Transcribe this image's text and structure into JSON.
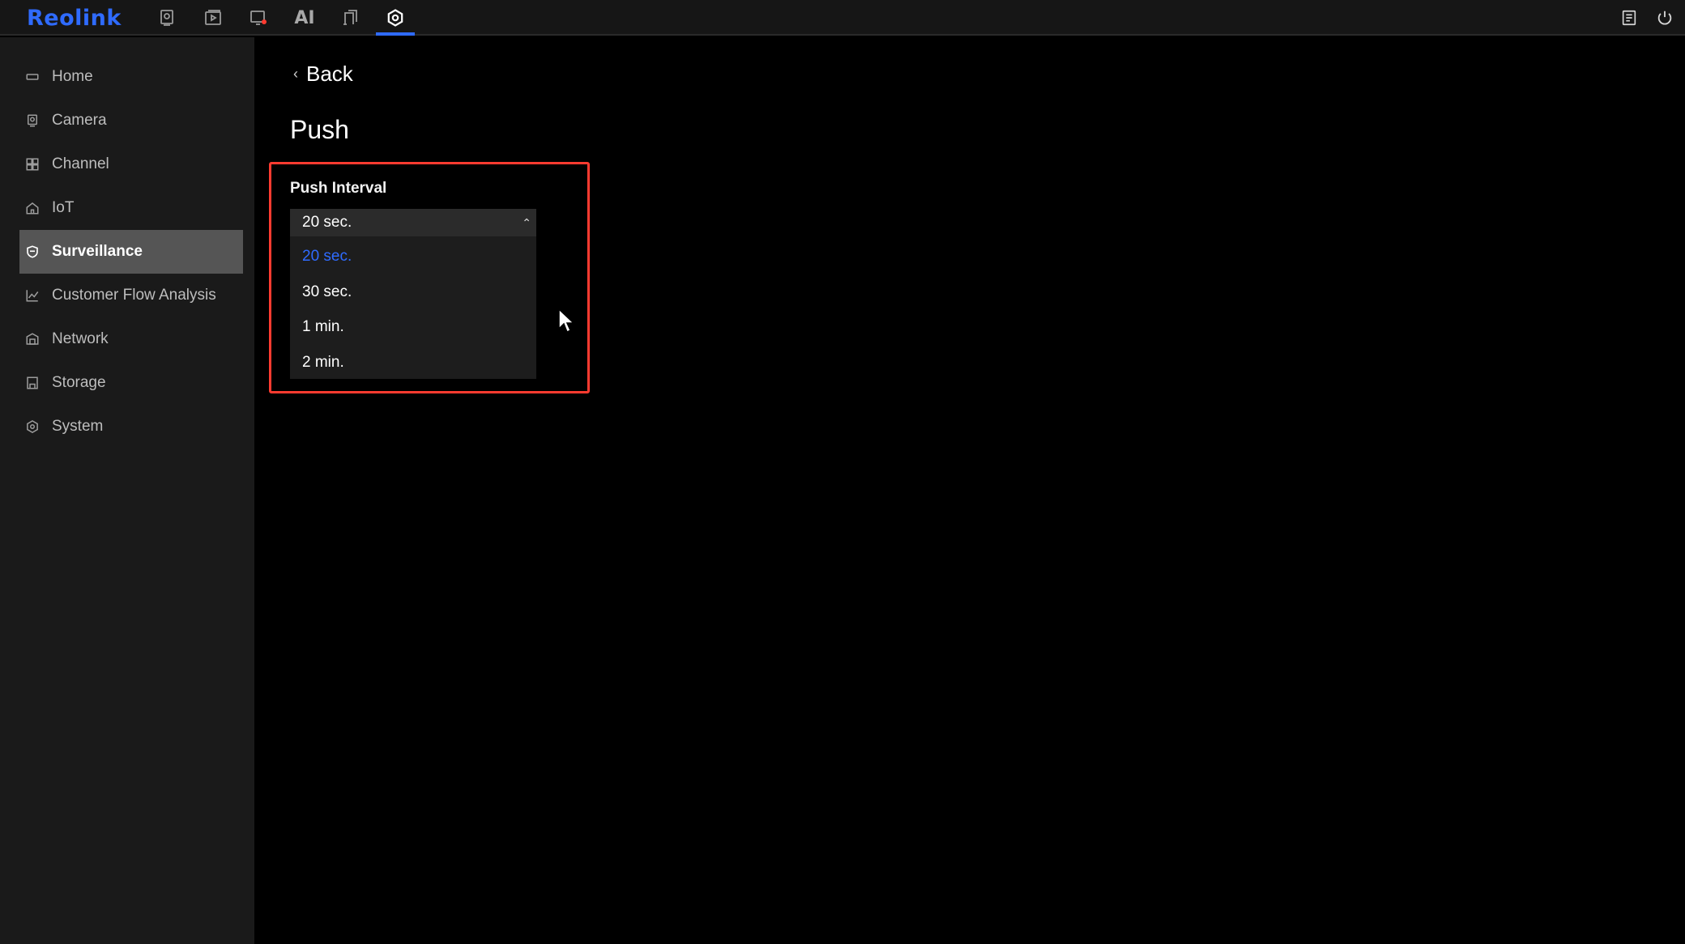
{
  "app": {
    "logo": "Reolink",
    "accent_color": "#2f6bff",
    "top_nav": [
      {
        "name": "live-view-icon"
      },
      {
        "name": "playback-icon"
      },
      {
        "name": "alarm-icon"
      },
      {
        "name": "ai",
        "label": "AI"
      },
      {
        "name": "files-icon"
      },
      {
        "name": "settings-icon",
        "active": true
      }
    ],
    "top_right": [
      {
        "name": "notes-icon"
      },
      {
        "name": "power-icon"
      }
    ]
  },
  "sidebar": {
    "items": [
      {
        "label": "Home",
        "icon": "home-icon"
      },
      {
        "label": "Camera",
        "icon": "camera-icon"
      },
      {
        "label": "Channel",
        "icon": "grid-icon"
      },
      {
        "label": "IoT",
        "icon": "house-icon"
      },
      {
        "label": "Surveillance",
        "icon": "shield-icon",
        "active": true
      },
      {
        "label": "Customer Flow Analysis",
        "icon": "chart-icon"
      },
      {
        "label": "Network",
        "icon": "network-icon"
      },
      {
        "label": "Storage",
        "icon": "storage-icon"
      },
      {
        "label": "System",
        "icon": "gear-icon"
      }
    ]
  },
  "main": {
    "back_label": "Back",
    "title": "Push",
    "push_interval": {
      "label": "Push Interval",
      "selected": "20 sec.",
      "options": [
        "20 sec.",
        "30 sec.",
        "1 min.",
        "2 min."
      ]
    },
    "highlight_color": "#ff3b30"
  }
}
